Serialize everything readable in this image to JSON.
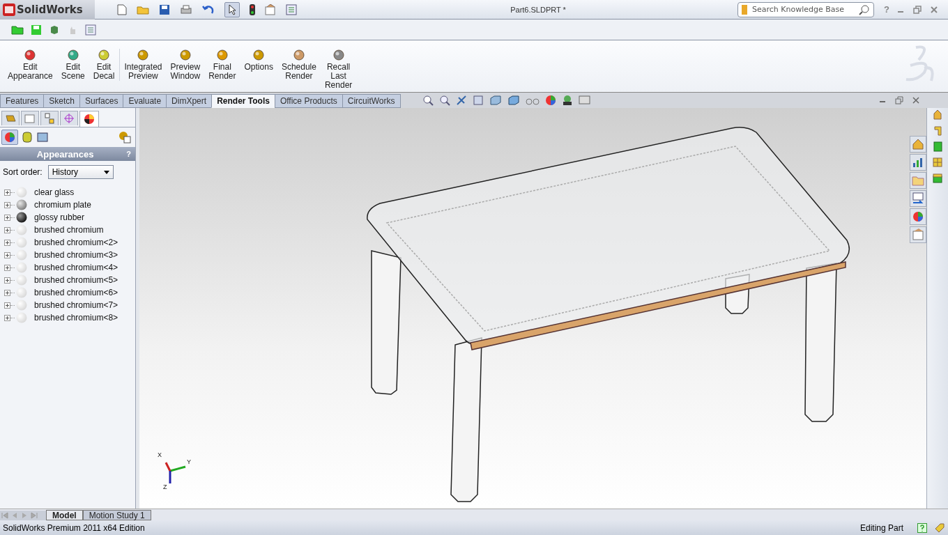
{
  "app": {
    "name": "SolidWorks"
  },
  "window": {
    "title": "Part6.SLDPRT *"
  },
  "search": {
    "placeholder": "Search Knowledge Base"
  },
  "help_menu": {
    "label": "?"
  },
  "ribbon": [
    {
      "label": "Edit Appearance",
      "kind": "appearance"
    },
    {
      "label": "Edit Scene",
      "kind": "scene"
    },
    {
      "label": "Edit Decal",
      "kind": "decal"
    },
    {
      "label": "Integrated Preview",
      "kind": "preview"
    },
    {
      "label": "Preview Window",
      "kind": "window"
    },
    {
      "label": "Final Render",
      "kind": "render"
    },
    {
      "label": "Options",
      "kind": "options"
    },
    {
      "label": "Schedule Render",
      "kind": "schedule"
    },
    {
      "label": "Recall Last Render",
      "kind": "recall"
    }
  ],
  "command_tabs": [
    {
      "label": "Features",
      "selected": false
    },
    {
      "label": "Sketch",
      "selected": false
    },
    {
      "label": "Surfaces",
      "selected": false
    },
    {
      "label": "Evaluate",
      "selected": false
    },
    {
      "label": "DimXpert",
      "selected": false
    },
    {
      "label": "Render Tools",
      "selected": true
    },
    {
      "label": "Office Products",
      "selected": false
    },
    {
      "label": "CircuitWorks",
      "selected": false
    }
  ],
  "panel": {
    "title": "Appearances",
    "help": "?",
    "sort_label": "Sort order:",
    "sort_value": "History",
    "items": [
      {
        "name": "clear glass",
        "kind": "light"
      },
      {
        "name": "chromium plate",
        "kind": "grey"
      },
      {
        "name": "glossy rubber",
        "kind": "dark"
      },
      {
        "name": "brushed chromium",
        "kind": "light"
      },
      {
        "name": "brushed chromium<2>",
        "kind": "light"
      },
      {
        "name": "brushed chromium<3>",
        "kind": "light"
      },
      {
        "name": "brushed chromium<4>",
        "kind": "light"
      },
      {
        "name": "brushed chromium<5>",
        "kind": "light"
      },
      {
        "name": "brushed chromium<6>",
        "kind": "light"
      },
      {
        "name": "brushed chromium<7>",
        "kind": "light"
      },
      {
        "name": "brushed chromium<8>",
        "kind": "light"
      }
    ]
  },
  "triad": {
    "x": "X",
    "y": "Y",
    "z": "Z"
  },
  "model_tabs": [
    {
      "label": "Model",
      "selected": true
    },
    {
      "label": "Motion Study 1",
      "selected": false
    }
  ],
  "status_bar": {
    "edition": "SolidWorks Premium 2011 x64 Edition",
    "mode": "Editing Part"
  }
}
